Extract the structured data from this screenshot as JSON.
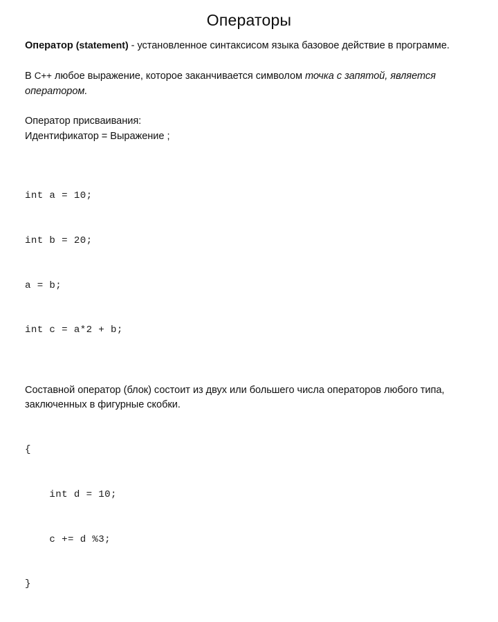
{
  "slide": {
    "title": "Операторы",
    "background_color": "#ffffff",
    "text_color": "#111111",
    "blocks": [
      {
        "id": "definition",
        "type": "paragraph",
        "runs": [
          {
            "text": "Оператор ",
            "style": "bold"
          },
          {
            "text": "(statement)",
            "style": "bold-condensed"
          },
          {
            "text": " - установленное синтаксисом языка базовое действие в программе.",
            "style": "regular"
          }
        ],
        "plain": "Оператор (statement) - установленное синтаксисом языка базовое действие в программе."
      },
      {
        "id": "expression-rule",
        "type": "paragraph",
        "runs": [
          {
            "text": "В ",
            "style": "regular"
          },
          {
            "text": "C++",
            "style": "latin-small"
          },
          {
            "text": " любое выражение, которое заканчивается символом ",
            "style": "regular"
          },
          {
            "text": "точка с запятой, является оператором.",
            "style": "italic"
          }
        ],
        "plain": "В C++ любое выражение, которое заканчивается символом точка с запятой, является оператором."
      },
      {
        "id": "assignment-heading",
        "type": "line",
        "text": "Оператор присваивания:"
      },
      {
        "id": "assignment-form",
        "type": "line",
        "text": "Идентификатор = Выражение ;"
      },
      {
        "id": "code-sample-1",
        "type": "code",
        "lines": [
          "int a = 10;",
          "int b = 20;",
          "a = b;",
          "int c = a*2 + b;"
        ]
      },
      {
        "id": "compound-statement",
        "type": "paragraph",
        "runs": [
          {
            "text": "Составной оператор (блок) состоит из двух или большего числа операторов любого типа, заключенных в фигурные скобки.",
            "style": "regular"
          }
        ],
        "plain": "Составной оператор (блок) состоит из двух или большего числа операторов любого типа, заключенных в фигурные скобки."
      },
      {
        "id": "code-sample-2",
        "type": "code",
        "lines": [
          "{",
          "    int d = 10;",
          "    c += d %3;",
          "}"
        ]
      }
    ]
  },
  "text": {
    "title": "Операторы",
    "def_bold": "Оператор ",
    "def_bold_latin": "(statement)",
    "def_rest": " - установленное синтаксисом языка базовое действие в программе.",
    "expr_pre": "В ",
    "expr_lang": "C++",
    "expr_mid": " любое выражение, которое заканчивается символом ",
    "expr_italic": "точка с запятой, является оператором.",
    "assign_heading": "Оператор присваивания:",
    "assign_form": "Идентификатор = Выражение ;",
    "code1_line1": "int a = 10;",
    "code1_line2": "int b = 20;",
    "code1_line3": "a = b;",
    "code1_line4": "int c = a*2 + b;",
    "compound": "Составной оператор (блок) состоит из двух или большего числа операторов любого типа, заключенных в фигурные скобки.",
    "code2_line1": "{",
    "code2_line2": "    int d = 10;",
    "code2_line3": "    c += d %3;",
    "code2_line4": "}"
  }
}
